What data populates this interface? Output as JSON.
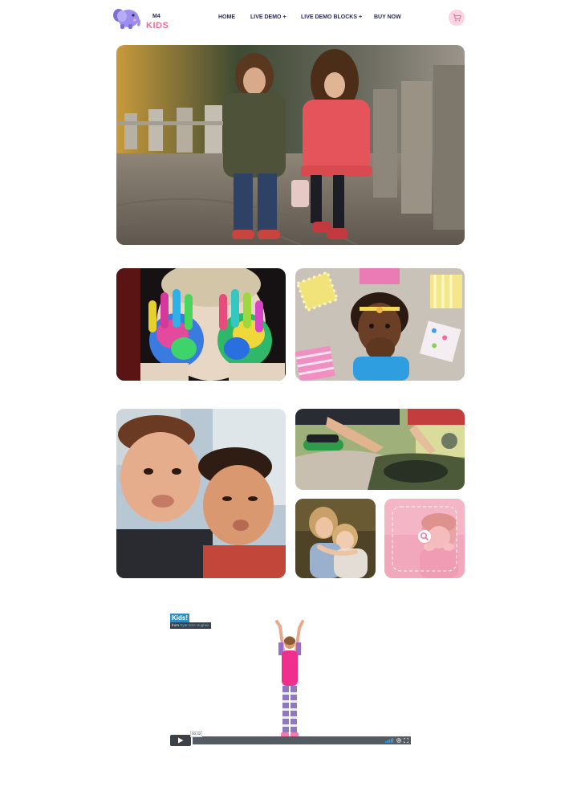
{
  "brand": {
    "logo_top": "M4",
    "logo_bottom": "KIDS",
    "accent": "#f06a9b",
    "navy": "#2b2a5a"
  },
  "nav": [
    {
      "label": "HOME"
    },
    {
      "label": "LIVE DEMO +"
    },
    {
      "label": "LIVE DEMO BLOCKS +"
    },
    {
      "label": "BUY NOW"
    }
  ],
  "cart": {
    "icon": "shopping-cart-icon"
  },
  "gallery": [
    {
      "name": "hero-photo",
      "subject": "two children standing on brick path"
    },
    {
      "name": "painted-hands-photo",
      "subject": "child with paint-covered hands"
    },
    {
      "name": "girl-covering-mouth-photo",
      "subject": "girl covering mouth in front of patterned papers"
    },
    {
      "name": "boys-funny-faces-photo",
      "subject": "two boys making funny faces"
    },
    {
      "name": "kids-at-water-photo",
      "subject": "children playing by water"
    },
    {
      "name": "sisters-hugging-photo",
      "subject": "two girls hugging"
    },
    {
      "name": "smiling-girl-photo",
      "subject": "smiling girl with zoom overlay"
    }
  ],
  "video": {
    "title": "Kids!",
    "byline_from": "from",
    "byline_author": "Ryan Eric Hughes",
    "time": "00:32",
    "play_icon": "play-icon",
    "volume_icon": "volume-icon",
    "settings_icon": "gear-icon",
    "fullscreen_icon": "fullscreen-icon"
  }
}
